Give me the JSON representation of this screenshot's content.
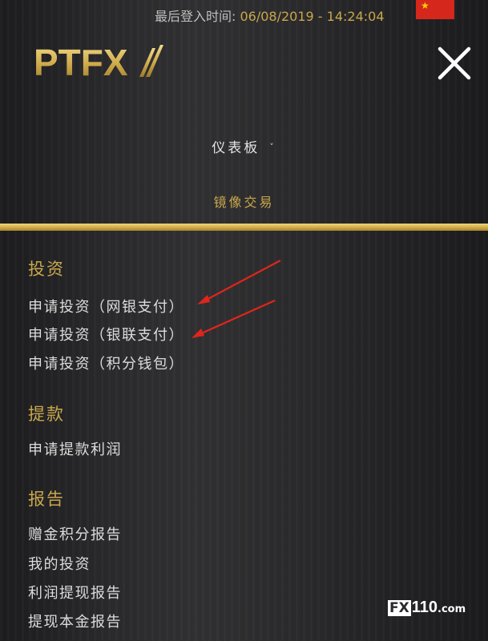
{
  "header": {
    "login_label": "最后登入时间:",
    "login_datetime": "06/08/2019 - 14:24:04",
    "brand": "PTFX",
    "flag_color": "#d6271c"
  },
  "menu": {
    "dashboard": "仪表板",
    "dashboard_chevron": "˅",
    "mirror_trading": "镜像交易"
  },
  "sections": {
    "invest": {
      "title": "投资",
      "items": [
        "申请投资（网银支付）",
        "申请投资（银联支付）",
        "申请投资（积分钱包）"
      ]
    },
    "withdraw": {
      "title": "提款",
      "items": [
        "申请提款利润"
      ]
    },
    "report": {
      "title": "报告",
      "items": [
        "赠金积分报告",
        "我的投资",
        "利润提现报告",
        "提现本金报告"
      ]
    }
  },
  "watermark": {
    "fx": "FX",
    "num": "110",
    "domain": ".com"
  },
  "colors": {
    "gold": "#c9a74c",
    "annotation_red": "#e0251b"
  }
}
